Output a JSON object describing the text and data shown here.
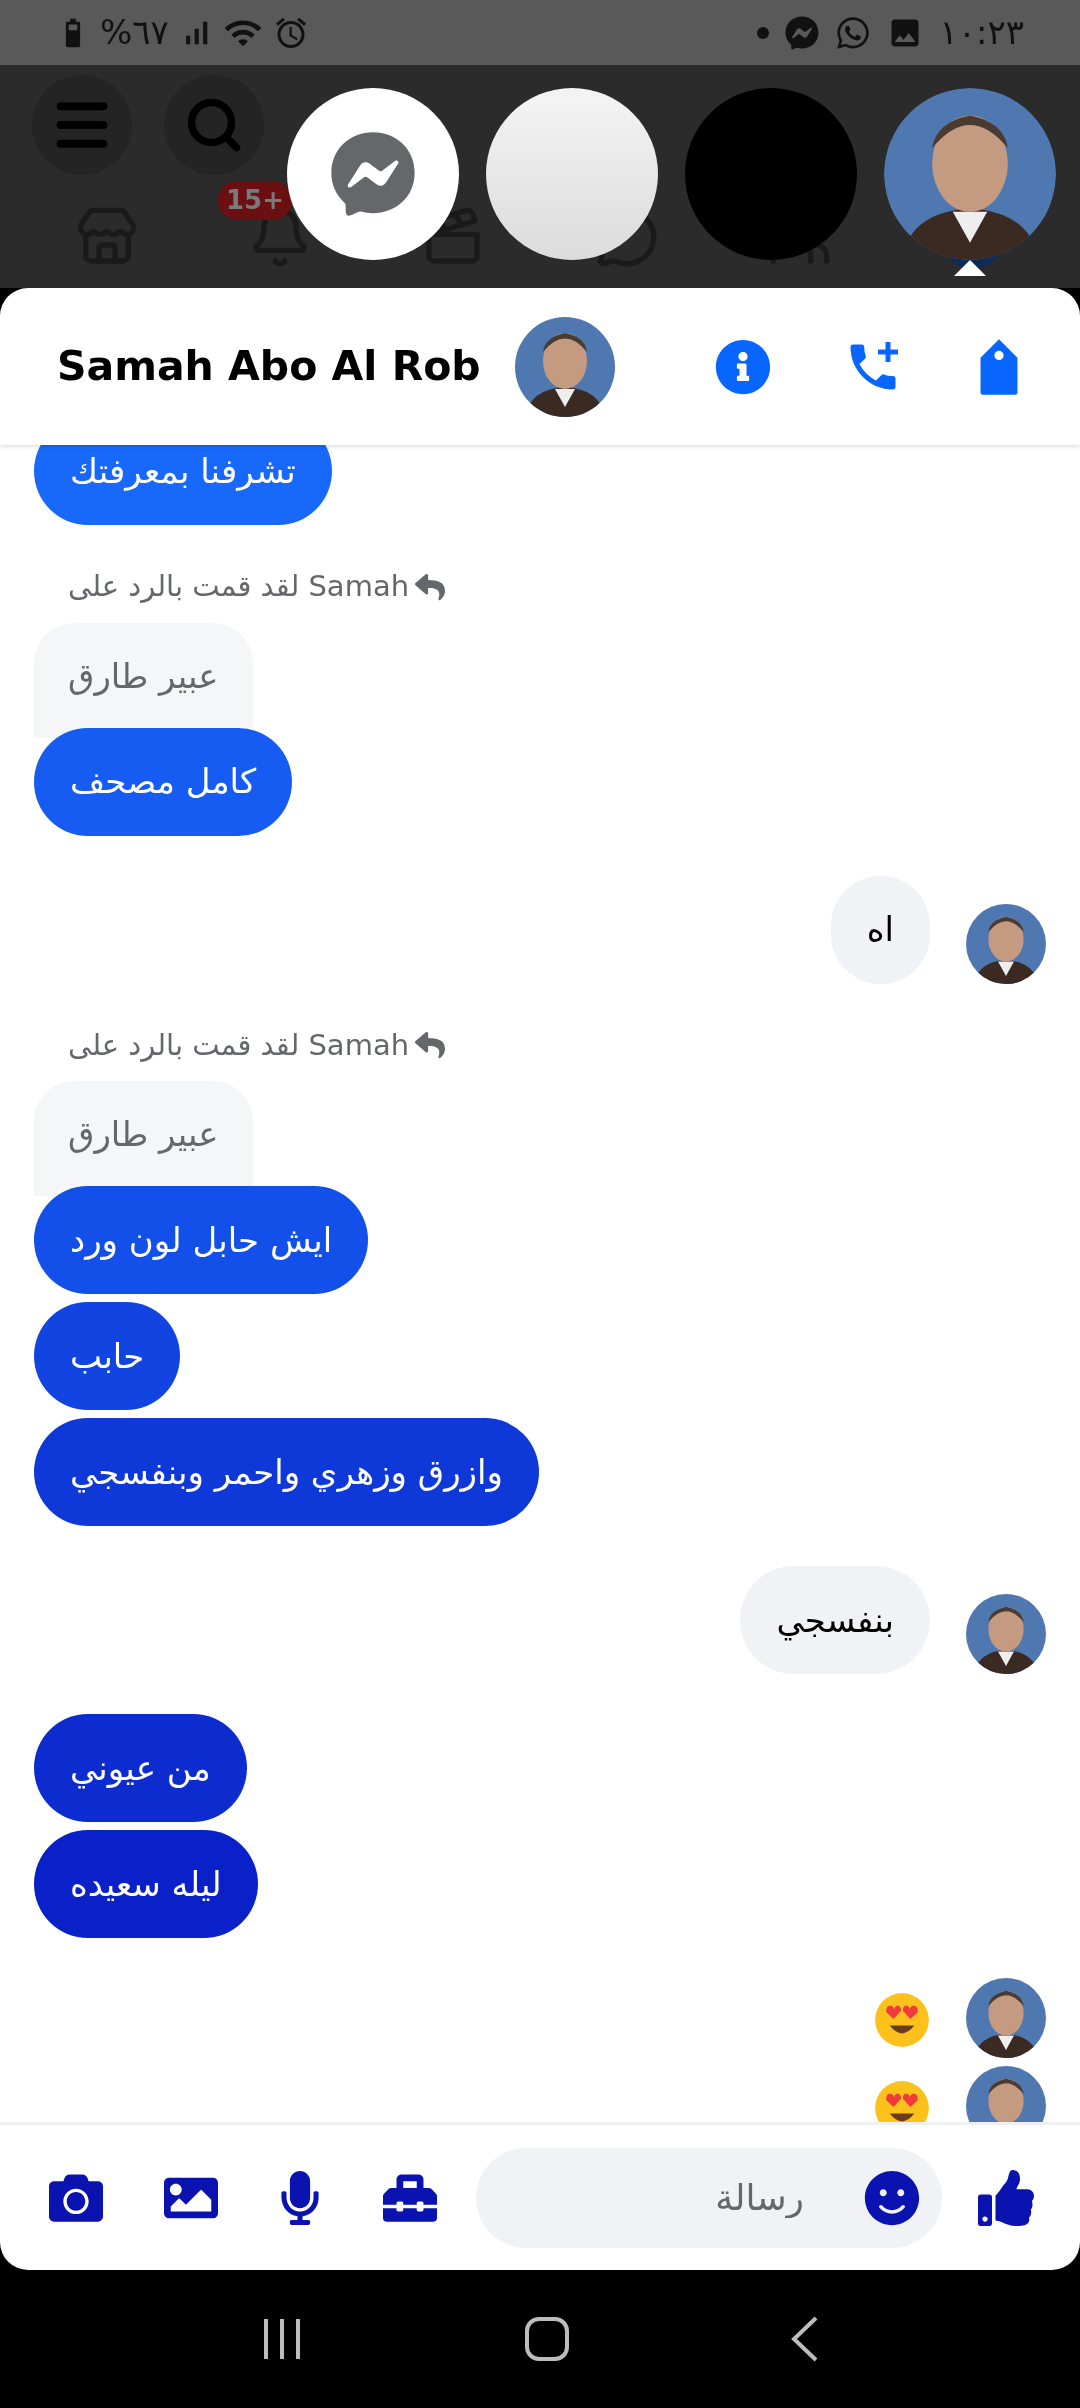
{
  "status_bar": {
    "battery": "%٦٧",
    "time": "١٠:٢٣"
  },
  "background": {
    "notification_badge": "15+"
  },
  "chat_heads": [
    {
      "kind": "messenger",
      "selected": false
    },
    {
      "kind": "light",
      "selected": false
    },
    {
      "kind": "dark",
      "selected": false
    },
    {
      "kind": "avatar",
      "selected": true
    }
  ],
  "header": {
    "name": "Samah Abo Al Rob"
  },
  "messages": [
    {
      "kind": "text",
      "outgoing": true,
      "text": "تشرفنا بمعرفتك"
    },
    {
      "kind": "reply",
      "outgoing": true,
      "label": "لقد قمت بالرد على Samah",
      "quote": "عبير طارق",
      "text": "كامل مصحف"
    },
    {
      "kind": "text",
      "outgoing": false,
      "text": "اه"
    },
    {
      "kind": "reply",
      "outgoing": true,
      "label": "لقد قمت بالرد على Samah",
      "quote": "عبير طارق",
      "text": "ايش حابل لون ورد"
    },
    {
      "kind": "text",
      "outgoing": true,
      "text": "حابب"
    },
    {
      "kind": "text",
      "outgoing": true,
      "text": "وازرق وزهري واحمر وبنفسجي"
    },
    {
      "kind": "text",
      "outgoing": false,
      "text": "بنفسجي"
    },
    {
      "kind": "text",
      "outgoing": true,
      "text": "من عيوني"
    },
    {
      "kind": "text",
      "outgoing": true,
      "text": "ليله سعيده"
    },
    {
      "kind": "emoji",
      "outgoing": false
    },
    {
      "kind": "emoji",
      "outgoing": false
    }
  ],
  "composer": {
    "placeholder": "رسالة"
  }
}
